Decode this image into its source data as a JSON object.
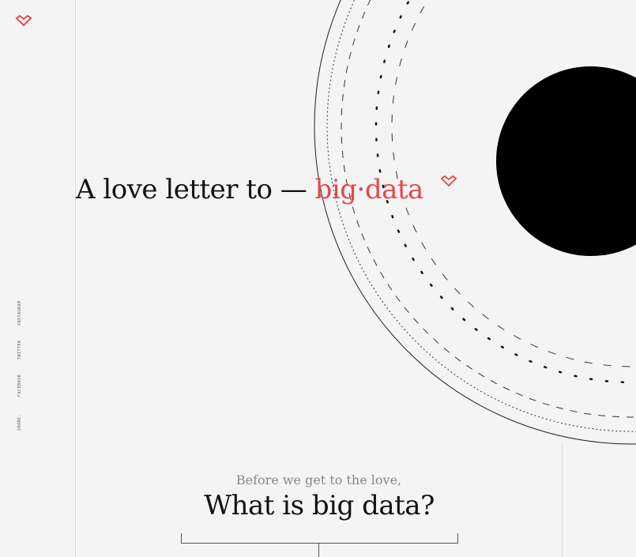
{
  "hero": {
    "title_prefix": "A love letter to —",
    "title_accent": "big·data"
  },
  "share": {
    "label": "SHARE:",
    "links": [
      "FACEBOOK",
      "TWITTER",
      "INSTAGRAM"
    ]
  },
  "section": {
    "kicker": "Before we get to the love,",
    "heading": "What is big data?"
  },
  "colors": {
    "accent": "#e8474a",
    "background": "#f4f4f4"
  },
  "icons": {
    "logo": "heart-chevron-icon"
  }
}
